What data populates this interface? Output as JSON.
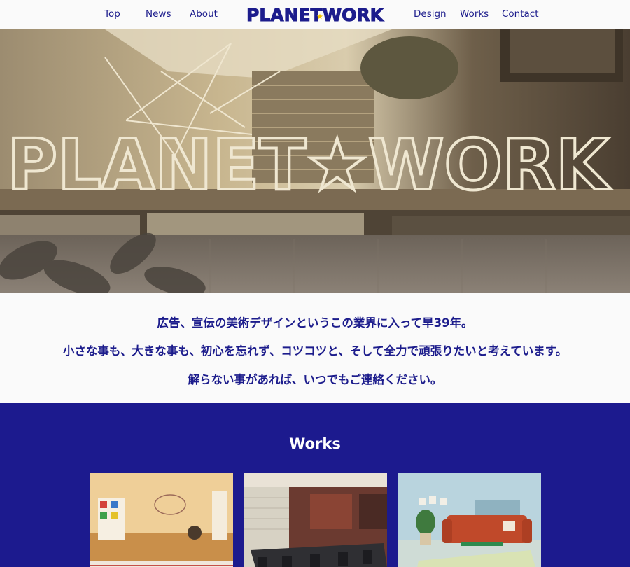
{
  "nav": {
    "left": [
      "Top",
      "News",
      "About"
    ],
    "right": [
      "Design",
      "Works",
      "Contact"
    ]
  },
  "logo": {
    "text": "PLANETWORK"
  },
  "hero": {
    "sign_text": "PLANET★WORK"
  },
  "intro": {
    "lines": [
      "広告、宣伝の美術デザインというこの業界に入って早39年。",
      "小さな事も、大きな事も、初心を忘れず、コツコツと、そして全力で頑張りたいと考えています。",
      "解らない事があれば、いつでもご連絡ください。"
    ]
  },
  "works": {
    "title": "Works",
    "thumbs": [
      "kids-room",
      "office-meeting-room",
      "living-room-red-sofa"
    ]
  },
  "colors": {
    "brand_navy": "#1c1c8c",
    "works_bg": "#1c1a8e",
    "logo_star": "#f5c400",
    "page_bg": "#fafafa"
  }
}
